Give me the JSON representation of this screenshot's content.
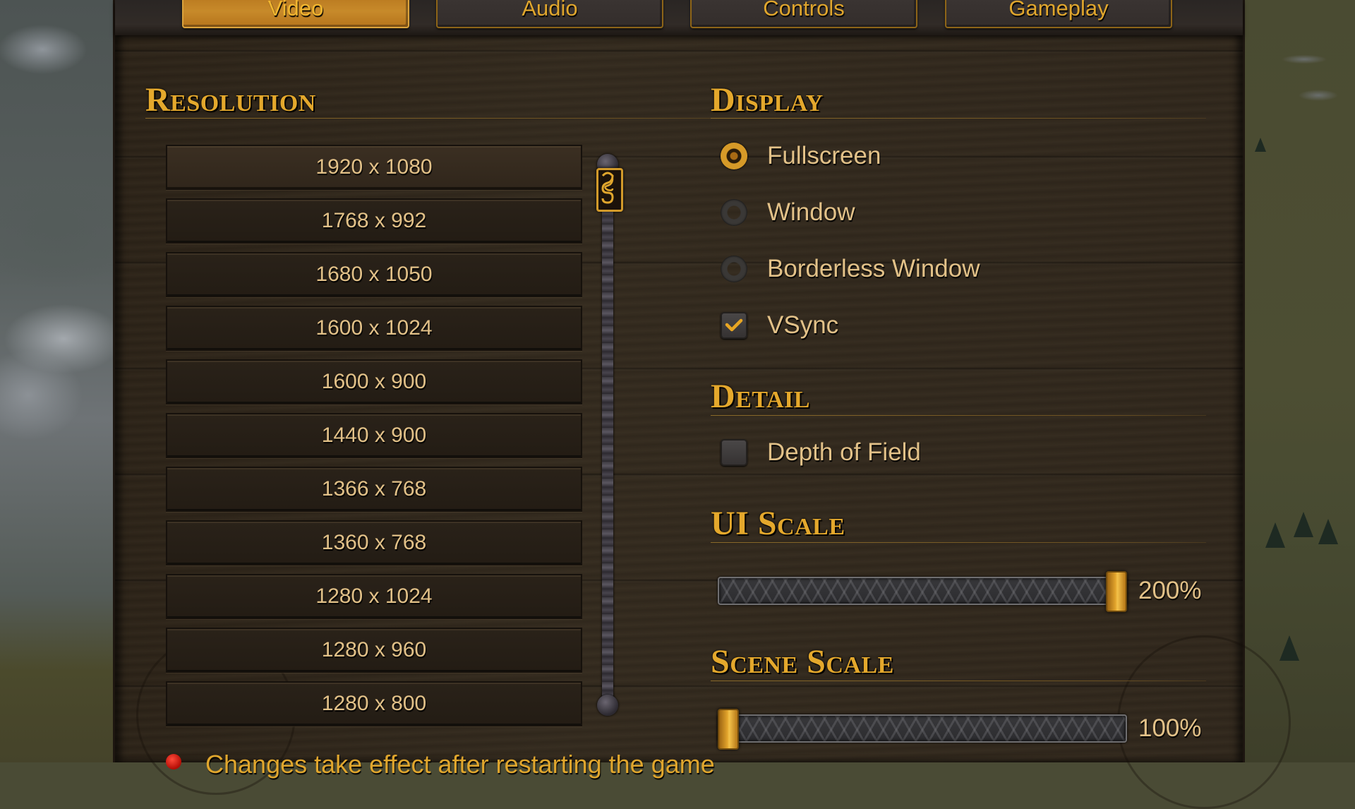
{
  "tabs": [
    {
      "label": "Video",
      "active": true
    },
    {
      "label": "Audio",
      "active": false
    },
    {
      "label": "Controls",
      "active": false
    },
    {
      "label": "Gameplay",
      "active": false
    }
  ],
  "resolution": {
    "heading": "Resolution",
    "selected": "1920 x 1080",
    "items": [
      "1920 x 1080",
      "1768 x 992",
      "1680 x 1050",
      "1600 x 1024",
      "1600 x 900",
      "1440 x 900",
      "1366 x 768",
      "1360 x 768",
      "1280 x 1024",
      "1280 x 960",
      "1280 x 800"
    ]
  },
  "display": {
    "heading": "Display",
    "options": [
      {
        "label": "Fullscreen",
        "type": "radio",
        "checked": true
      },
      {
        "label": "Window",
        "type": "radio",
        "checked": false
      },
      {
        "label": "Borderless Window",
        "type": "radio",
        "checked": false
      },
      {
        "label": "VSync",
        "type": "checkbox",
        "checked": true
      }
    ]
  },
  "detail": {
    "heading": "Detail",
    "options": [
      {
        "label": "Depth of Field",
        "type": "checkbox",
        "checked": false
      }
    ]
  },
  "ui_scale": {
    "heading": "UI Scale",
    "value_label": "200%",
    "fraction": 1.0
  },
  "scene_scale": {
    "heading": "Scene Scale",
    "value_label": "100%",
    "fraction": 0.0
  },
  "footer": {
    "notice": "Changes take effect after restarting the game"
  },
  "colors": {
    "accent_gold": "#e4a82c",
    "label_text": "#e2c188",
    "notice_dot": "#d0150c"
  }
}
